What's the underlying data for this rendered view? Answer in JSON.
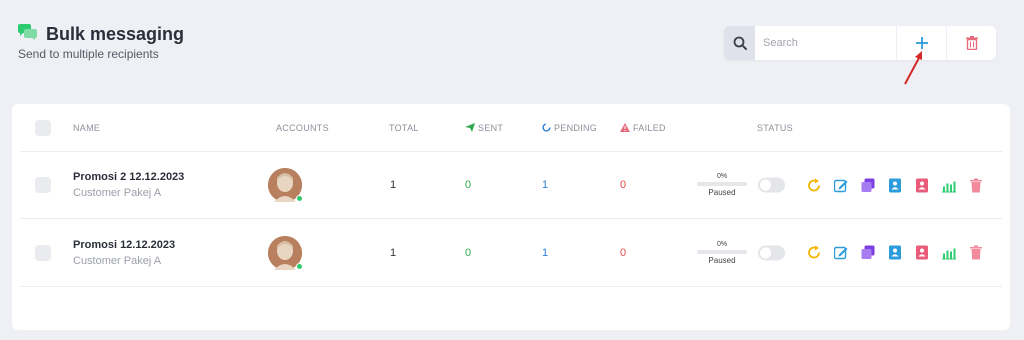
{
  "header": {
    "title": "Bulk messaging",
    "subtitle": "Send to multiple recipients",
    "icon": "chat-bubbles-icon",
    "accent": "#2ecc71"
  },
  "toolbar": {
    "search_placeholder": "Search",
    "add_color": "#2d9cdb",
    "delete_color": "#e66b7a"
  },
  "table": {
    "columns": {
      "name": "NAME",
      "accounts": "ACCOUNTS",
      "total": "TOTAL",
      "sent": "SENT",
      "pending": "PENDING",
      "failed": "FAILED",
      "status": "STATUS"
    },
    "rows": [
      {
        "name": "Promosi 2 12.12.2023",
        "group": "Customer Pakej A",
        "total": "1",
        "sent": "0",
        "pending": "1",
        "failed": "0",
        "progress": "0%",
        "progress_value": 0,
        "state": "Paused"
      },
      {
        "name": "Promosi 12.12.2023",
        "group": "Customer Pakej A",
        "total": "1",
        "sent": "0",
        "pending": "1",
        "failed": "0",
        "progress": "0%",
        "progress_value": 0,
        "state": "Paused"
      }
    ]
  },
  "colors": {
    "sent": "#2ea84f",
    "pending": "#2d7fd8",
    "failed": "#e14b4b"
  }
}
